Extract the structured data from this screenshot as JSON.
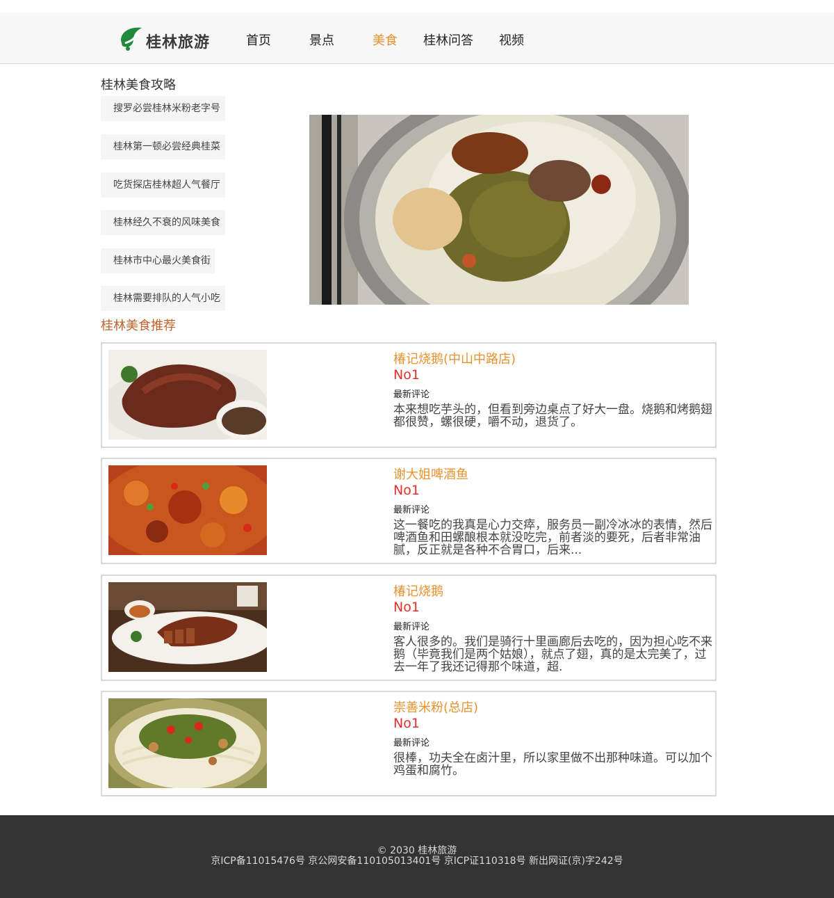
{
  "header": {
    "logo_text": "桂林旅游",
    "nav": [
      {
        "label": "首页",
        "active": false
      },
      {
        "label": "景点",
        "active": false
      },
      {
        "label": "美食",
        "active": true
      },
      {
        "label": "桂林问答",
        "active": false
      },
      {
        "label": "视频",
        "active": false
      }
    ]
  },
  "guide": {
    "title": "桂林美食攻略",
    "items": [
      "搜罗必尝桂林米粉老字号",
      "桂林第一顿必尝经典桂菜",
      "吃货探店桂林超人气餐厅",
      "桂林经久不衰的风味美食",
      "桂林市中心最火美食街",
      "桂林需要排队的人气小吃"
    ]
  },
  "hero": {
    "icon": "rice-noodle-bowl-photo"
  },
  "recommend": {
    "title": "桂林美食推荐",
    "comment_label": "最新评论",
    "cards": [
      {
        "name": "椿记烧鹅(中山中路店)",
        "rank": "No1",
        "text": "本来想吃芋头的，但看到旁边桌点了好大一盘。烧鹅和烤鹅翅都很赞，螺很硬，嚼不动，退货了。",
        "image": "roast-goose-photo"
      },
      {
        "name": "谢大姐啤酒鱼",
        "rank": "No1",
        "text": "这一餐吃的我真是心力交瘁，服务员一副冷冰冰的表情，然后啤酒鱼和田螺酿根本就没吃完，前者淡的要死，后者非常油腻，反正就是各种不合胃口，后来...",
        "image": "beer-fish-photo"
      },
      {
        "name": "椿记烧鹅",
        "rank": "No1",
        "text": "客人很多的。我们是骑行十里画廊后去吃的，因为担心吃不来鹅（毕竟我们是两个姑娘），就点了翅，真的是太完美了，过去一年了我还记得那个味道，超.",
        "image": "roast-goose-plate-photo"
      },
      {
        "name": "崇善米粉(总店)",
        "rank": "No1",
        "text": "很棒，功夫全在卤汁里，所以家里做不出那种味道。可以加个鸡蛋和腐竹。",
        "image": "rice-noodle-photo"
      }
    ]
  },
  "footer": {
    "copyright": "© 2030 桂林旅游",
    "icp": "京ICP备11015476号 京公网安备110105013401号 京ICP证110318号 新出网证(京)字242号"
  },
  "colors": {
    "accent": "#e8922e",
    "rank": "#e0312a",
    "section_title": "#c0622a",
    "footer_bg": "#333333"
  }
}
